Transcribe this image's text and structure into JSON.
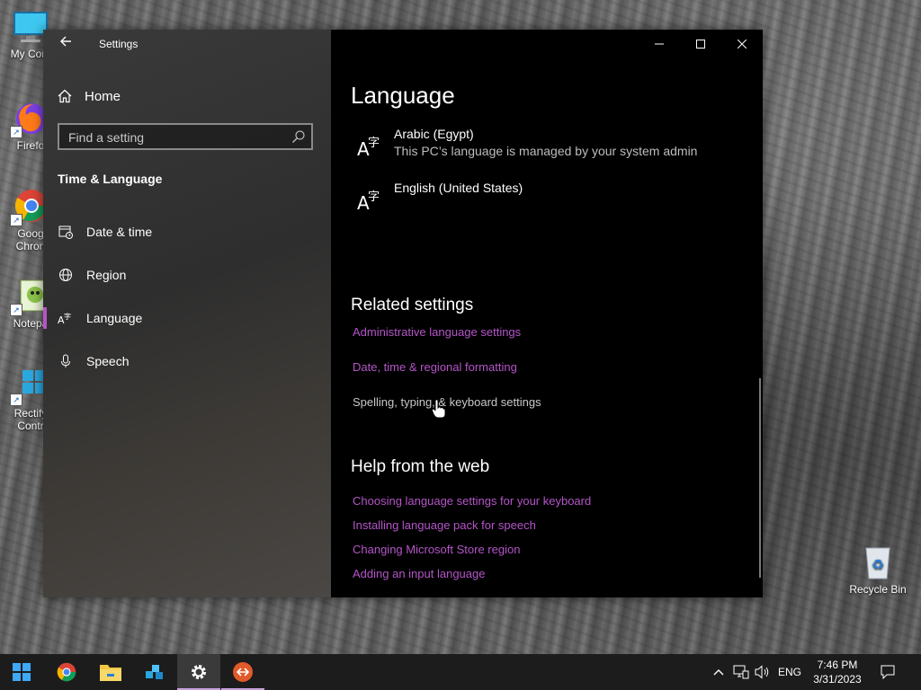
{
  "desktop": {
    "icons": [
      {
        "label": "My Com",
        "icon": "monitor-icon"
      },
      {
        "label": "Firefo",
        "icon": "firefox-icon"
      },
      {
        "label": "Goog\nChron",
        "icon": "chrome-icon"
      },
      {
        "label": "Notepa",
        "icon": "notepad-icon"
      },
      {
        "label": "Rectify\nContr",
        "icon": "rectify-icon"
      },
      {
        "label": "Recycle Bin",
        "icon": "recycle-bin-icon"
      }
    ]
  },
  "window": {
    "title": "Settings",
    "sidebar": {
      "home_label": "Home",
      "search_placeholder": "Find a setting",
      "section_title": "Time & Language",
      "items": [
        {
          "label": "Date & time",
          "icon": "calendar-clock-icon"
        },
        {
          "label": "Region",
          "icon": "globe-icon"
        },
        {
          "label": "Language",
          "icon": "language-icon",
          "selected": true
        },
        {
          "label": "Speech",
          "icon": "microphone-icon"
        }
      ]
    },
    "content": {
      "heading": "Language",
      "languages": [
        {
          "name": "Arabic (Egypt)",
          "note": "This PC’s language is managed by your system admin"
        },
        {
          "name": "English (United States)",
          "note": ""
        }
      ],
      "related_heading": "Related settings",
      "related_links": [
        "Administrative language settings",
        "Date, time & regional formatting",
        "Spelling, typing, & keyboard settings"
      ],
      "help_heading": "Help from the web",
      "help_links": [
        "Choosing language settings for your keyboard",
        "Installing language pack for speech",
        "Changing Microsoft Store region",
        "Adding an input language"
      ],
      "lang_icon_text": "A字"
    }
  },
  "taskbar": {
    "apps": [
      "start-icon",
      "chrome-icon",
      "file-explorer-icon",
      "network-tool-icon",
      "settings-gear-icon",
      "remote-desktop-icon"
    ],
    "tray": {
      "language": "ENG",
      "time": "7:46 PM",
      "date": "3/31/2023"
    }
  },
  "colors": {
    "link": "#b455c8",
    "accent_underline": "#c9a0dc"
  }
}
